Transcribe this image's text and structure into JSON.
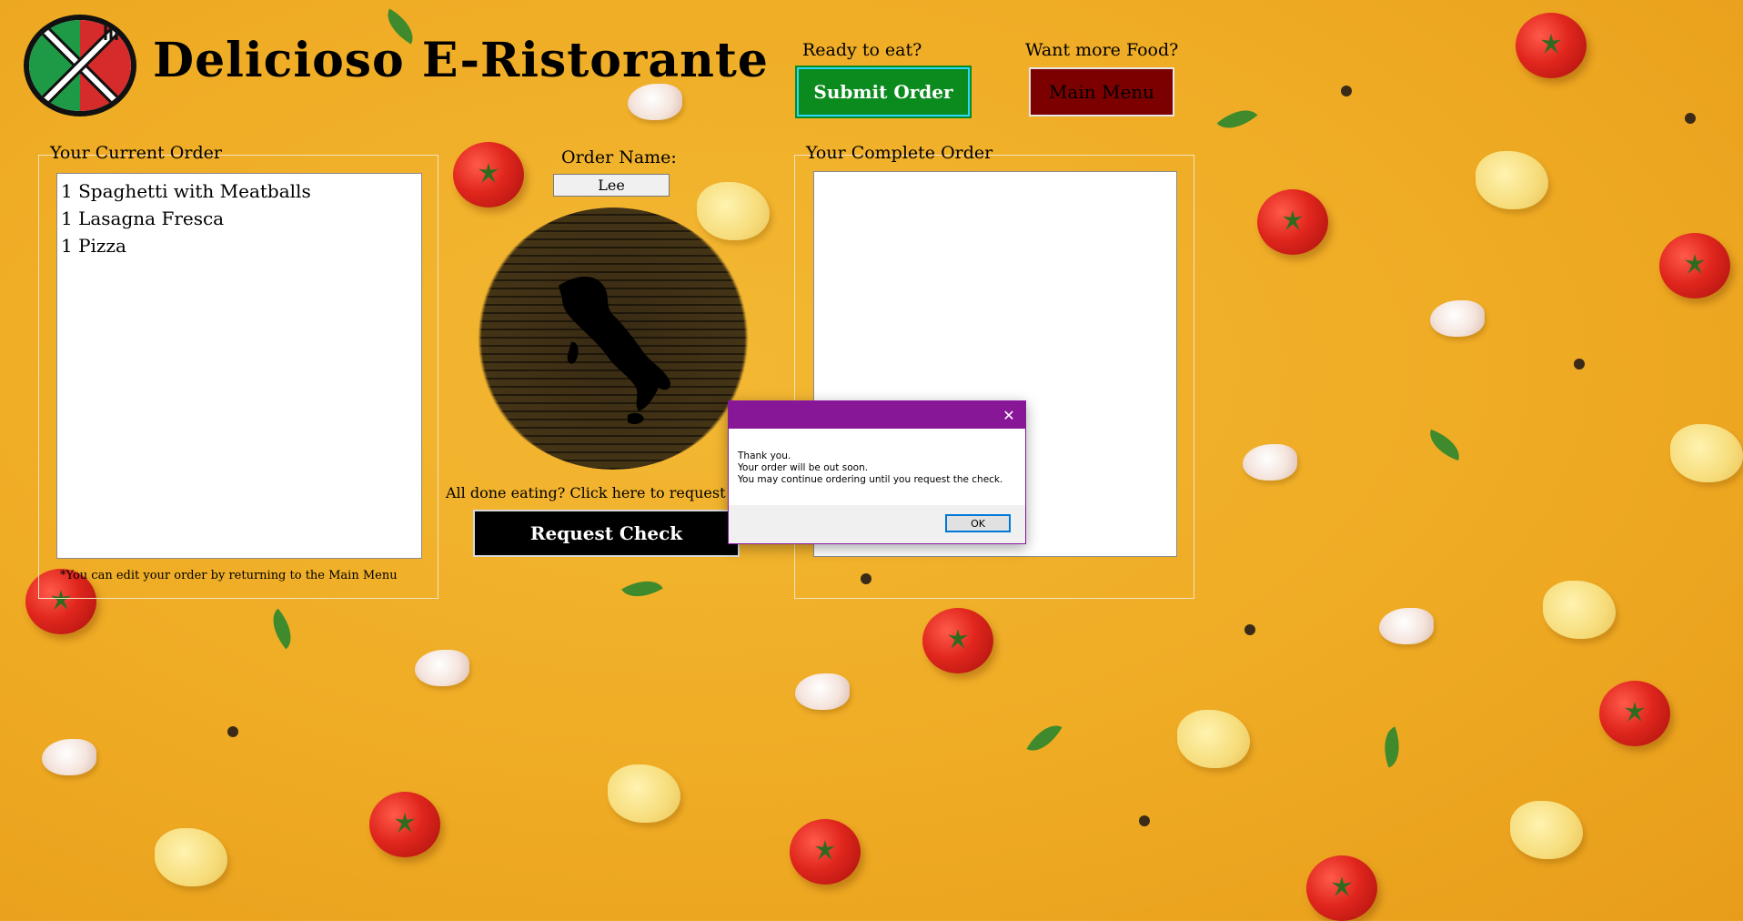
{
  "header": {
    "title": "Delicioso  E-Ristorante",
    "logo_icon": "plate-fork-knife-icon"
  },
  "actions": {
    "ready_label": "Ready to eat?",
    "submit_label": "Submit Order",
    "more_food_label": "Want more Food?",
    "main_menu_label": "Main Menu"
  },
  "current_order": {
    "title": "Your Current Order",
    "items": [
      "1 Spaghetti with Meatballs",
      "1 Lasagna Fresca",
      "1 Pizza"
    ],
    "note": "*You can edit your order by returning to the Main Menu"
  },
  "order_name": {
    "label": "Order Name:",
    "value": "Lee"
  },
  "check": {
    "prompt": "All done eating? Click here to request your",
    "button_label": "Request Check"
  },
  "complete_order": {
    "title": "Your Complete Order",
    "items": []
  },
  "dialog": {
    "close_icon": "close-icon",
    "lines": [
      "Thank you.",
      "Your order will be out soon.",
      "You may continue ordering until you request the check."
    ],
    "ok_label": "OK"
  },
  "colors": {
    "submit_green": "#0b8a1d",
    "menu_red": "#7d0000",
    "dialog_purple": "#881798",
    "background_yellow": "#efab24"
  }
}
